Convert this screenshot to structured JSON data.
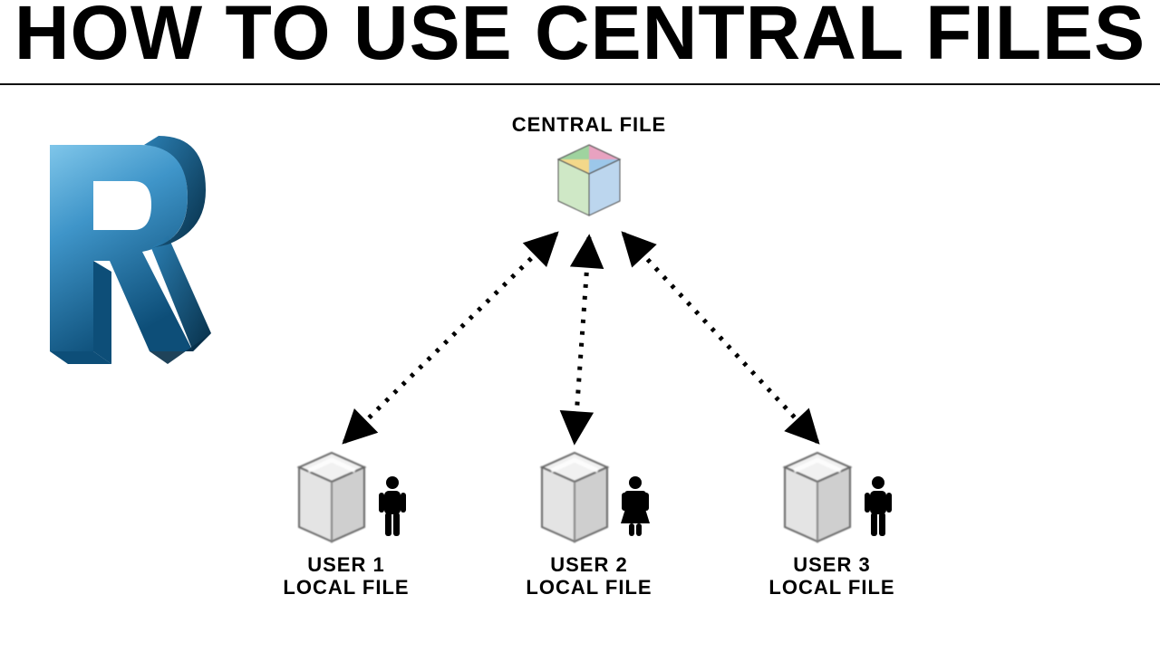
{
  "title": "HOW TO USE CENTRAL FILES",
  "central": {
    "label": "CENTRAL FILE"
  },
  "users": [
    {
      "line1": "USER 1",
      "line2": "LOCAL FILE"
    },
    {
      "line1": "USER 2",
      "line2": "LOCAL FILE"
    },
    {
      "line1": "USER 3",
      "line2": "LOCAL FILE"
    }
  ],
  "colors": {
    "logo_top": "#4aa9d8",
    "logo_mid": "#2b7fb3",
    "logo_dark": "#0d4e78"
  }
}
